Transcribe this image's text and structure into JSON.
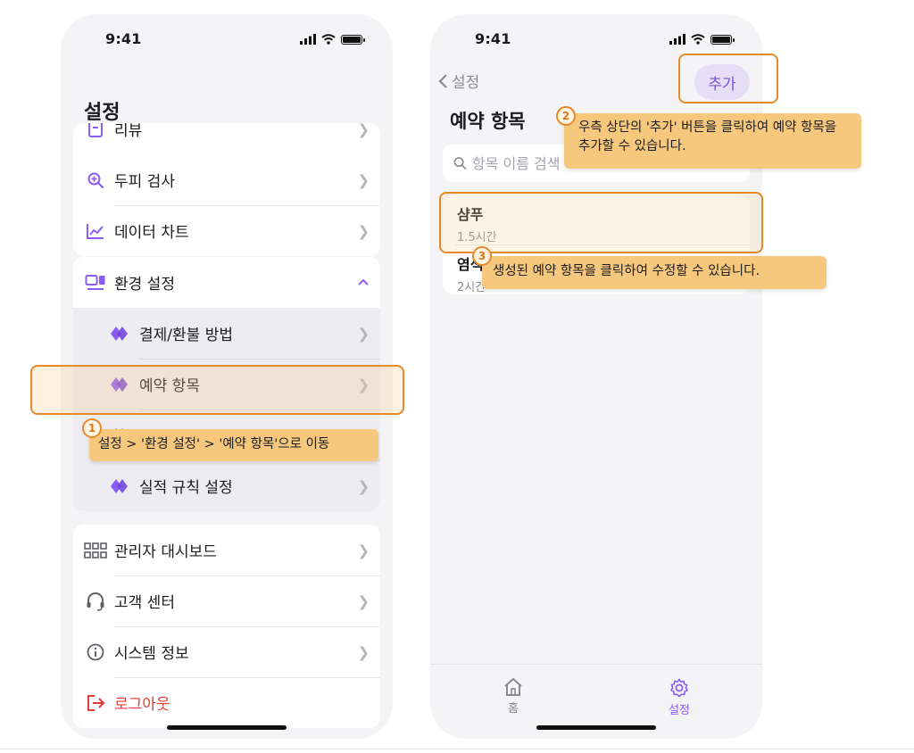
{
  "phone1": {
    "status": {
      "time": "9:41"
    },
    "title": "설정",
    "top_partial_label": "리뷰",
    "group1": [
      {
        "label": "두피 검사",
        "icon": "zoom-plus-icon"
      },
      {
        "label": "데이터 차트",
        "icon": "trend-chart-icon"
      }
    ],
    "env": {
      "label": "환경 설정",
      "icon": "dashboard-icon"
    },
    "env_sub": [
      {
        "label": "결제/환불 방법"
      },
      {
        "label": "예약 항목"
      },
      {
        "label": ""
      },
      {
        "label": "실적 규칙 설정"
      }
    ],
    "group3": [
      {
        "label": "관리자 대시보드",
        "icon": "grid-icon"
      },
      {
        "label": "고객 센터",
        "icon": "headset-icon"
      },
      {
        "label": "시스템 정보",
        "icon": "info-icon"
      }
    ],
    "logout": "로그아웃"
  },
  "phone2": {
    "status": {
      "time": "9:41"
    },
    "back_label": "설정",
    "add_button": "추가",
    "title": "예약 항목",
    "search": {
      "placeholder": "항목 이름 검색"
    },
    "items": [
      {
        "name": "샴푸",
        "duration": "1.5시간"
      },
      {
        "name": "염색",
        "duration": "2시간"
      }
    ],
    "tabs": [
      {
        "label": "홈",
        "icon": "home-icon"
      },
      {
        "label": "설정",
        "icon": "gear-icon"
      }
    ]
  },
  "callouts": [
    {
      "number": "1",
      "text": "설정 > '환경 설정' > '예약 항목'으로 이동"
    },
    {
      "number": "2",
      "text": "우측 상단의 '추가' 버튼을 클릭하여 예약 항목을 추가할 수 있습니다."
    },
    {
      "number": "3",
      "text": "생성된 예약 항목을 클릭하여 수정할 수 있습니다."
    }
  ],
  "colors": {
    "accent": "#8b5cf6",
    "callout": "#f6c87d",
    "callout_border": "#e5892a",
    "logout": "#e53935"
  }
}
